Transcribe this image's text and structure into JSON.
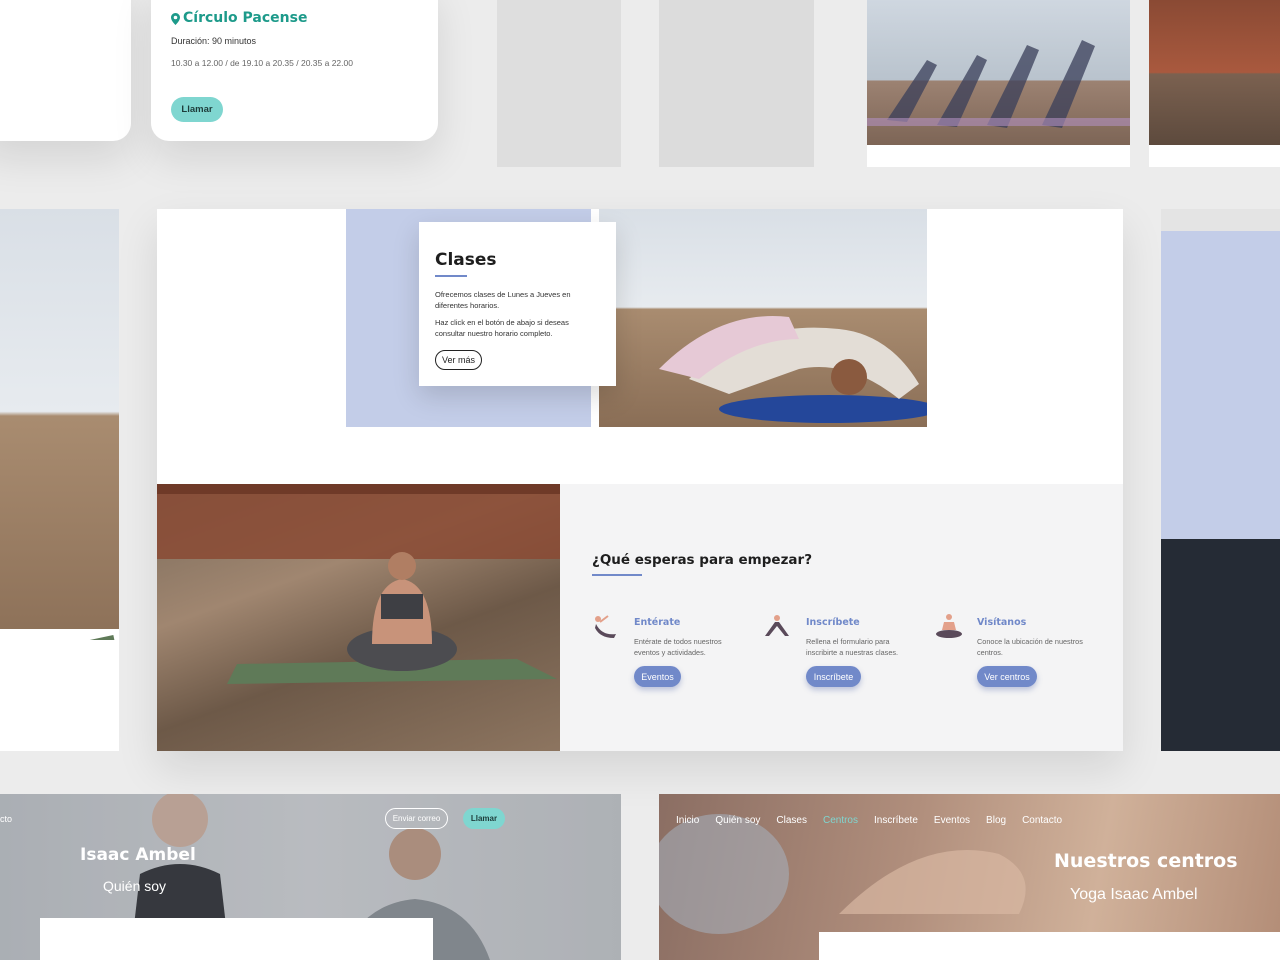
{
  "top_card": {
    "title": "Círculo Pacense",
    "duration": "Duración: 90 minutos",
    "times": "10.30 a 12.00 / de 19.10 a 20.35 / 20.35 a 22.00",
    "call_label": "Llamar"
  },
  "classes": {
    "title": "Clases",
    "text1": "Ofrecemos clases de Lunes a Jueves en diferentes horarios.",
    "text2": "Haz click en el botón de abajo si deseas consultar nuestro horario completo.",
    "button_label": "Ver más"
  },
  "cta": {
    "heading": "¿Qué esperas para empezar?",
    "items": [
      {
        "title": "Entérate",
        "text": "Entérate de todos nuestros eventos y actividades.",
        "button": "Eventos",
        "icon": "yoga-pose-icon"
      },
      {
        "title": "Inscríbete",
        "text": "Rellena el formulario para inscribirte a nuestras clases.",
        "button": "Inscríbete",
        "icon": "yoga-stretch-icon"
      },
      {
        "title": "Visítanos",
        "text": "Conoce la ubicación de nuestros centros.",
        "button": "Ver centros",
        "icon": "meditation-icon"
      }
    ]
  },
  "about_hero": {
    "nav_fragment": "cto",
    "email_label": "Enviar correo",
    "call_label": "Llamar",
    "name": "Isaac Ambel",
    "subtitle": "Quién soy"
  },
  "centers_hero": {
    "nav": [
      "Inicio",
      "Quién soy",
      "Clases",
      "Centros",
      "Inscríbete",
      "Eventos",
      "Blog",
      "Contacto"
    ],
    "active_nav": "Centros",
    "title": "Nuestros centros",
    "subtitle": "Yoga Isaac Ambel"
  },
  "colors": {
    "teal": "#7fd6d0",
    "teal_text": "#1d9a8a",
    "blue_accent": "#7189c9",
    "lavender": "#c3cde8",
    "dark_navy": "#252b35"
  }
}
